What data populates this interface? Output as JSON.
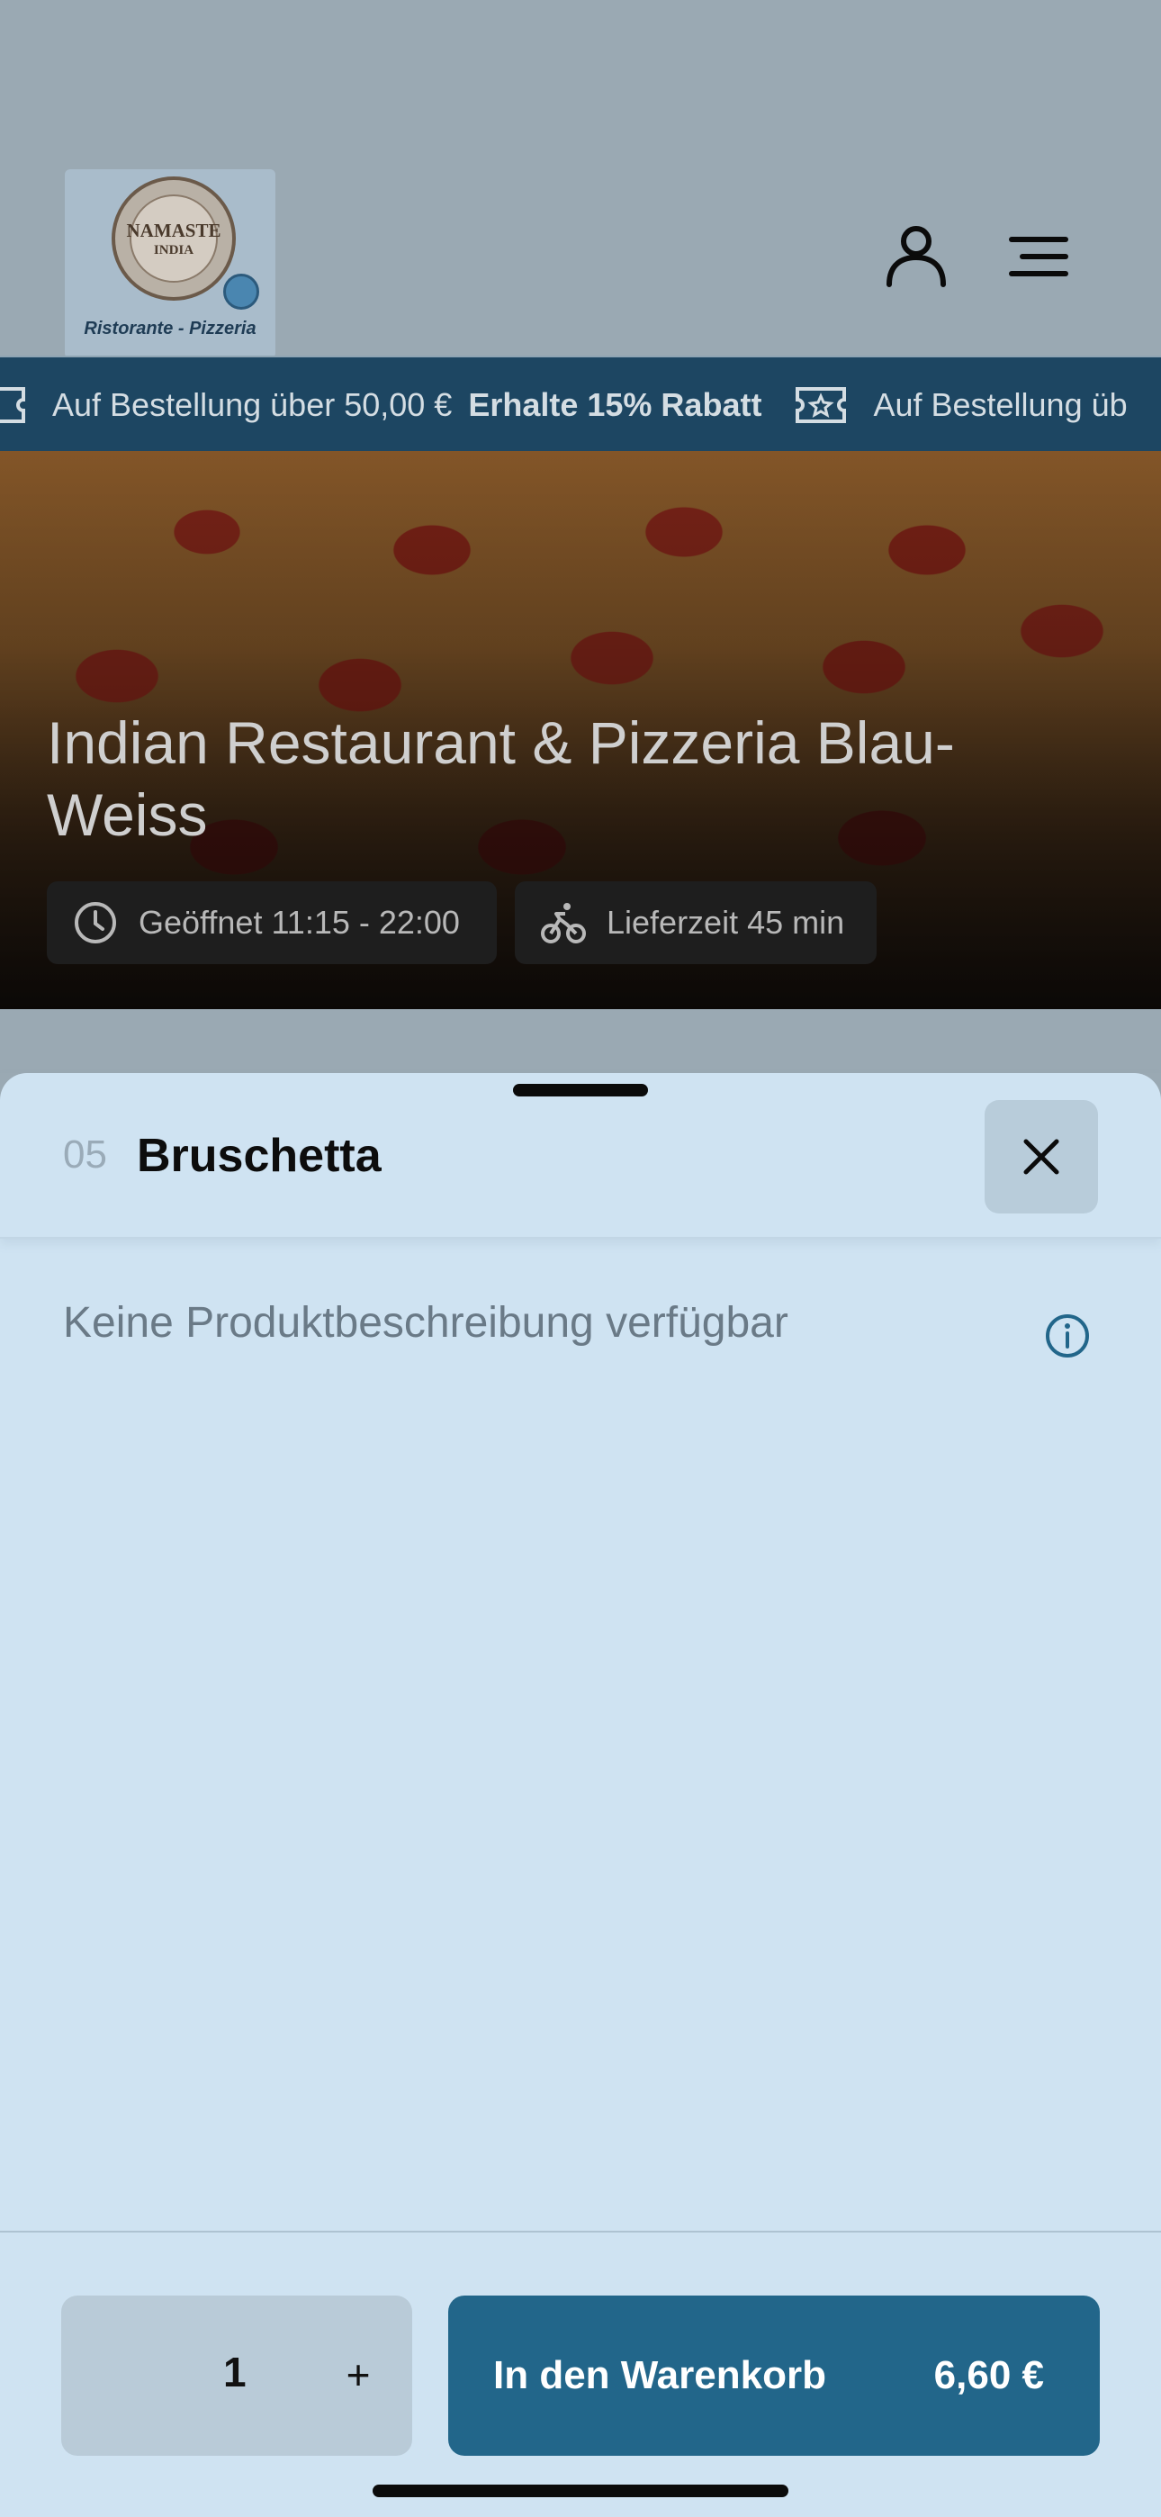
{
  "header": {
    "logo": {
      "line1": "NAMASTE",
      "line2": "INDIA",
      "subtitle": "Ristorante - Pizzeria"
    },
    "user_icon": "user-icon",
    "menu_icon": "menu-icon"
  },
  "banner": {
    "text": "Auf Bestellung über 50,00 €",
    "highlight": "Erhalte 15% Rabatt",
    "text_partial": "Auf Bestellung üb",
    "icon": "ticket-icon"
  },
  "hero": {
    "title": "Indian Restaurant & Pizzeria Blau-Weiss",
    "opening": "Geöffnet 11:15 - 22:00",
    "delivery": "Lieferzeit 45 min"
  },
  "product": {
    "number": "05",
    "name": "Bruschetta",
    "description": "Keine Produktbeschreibung verfügbar"
  },
  "footer": {
    "quantity": "1",
    "plus": "+",
    "add_to_cart": "In den Warenkorb",
    "price": "6,60 €"
  },
  "colors": {
    "accent": "#22668a",
    "banner": "#1d4662",
    "sheet": "#cfe3f2"
  }
}
